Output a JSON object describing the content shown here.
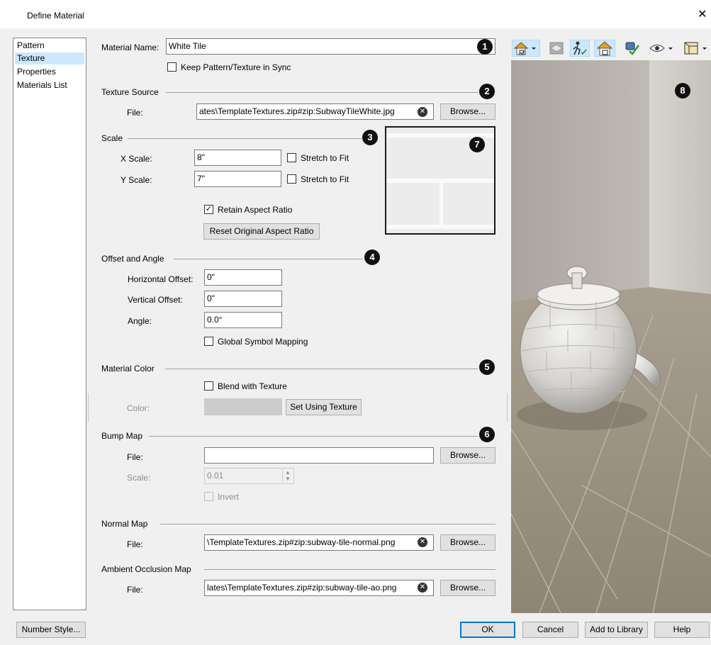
{
  "window": {
    "title": "Define Material",
    "close_glyph": "✕"
  },
  "nav": {
    "items": [
      "Pattern",
      "Texture",
      "Properties",
      "Materials List"
    ],
    "selected_index": 1
  },
  "material_name": {
    "label": "Material Name:",
    "value": "White Tile"
  },
  "keep_sync": {
    "label": "Keep Pattern/Texture in Sync",
    "checked": false
  },
  "texture_source": {
    "heading": "Texture Source",
    "file_label": "File:",
    "file_value": "ates\\TemplateTextures.zip#zip:SubwayTileWhite.jpg",
    "browse_label": "Browse..."
  },
  "scale": {
    "heading": "Scale",
    "x_label": "X Scale:",
    "x_value": "8\"",
    "y_label": "Y Scale:",
    "y_value": "7\"",
    "stretch_label": "Stretch to Fit",
    "retain_label": "Retain Aspect Ratio",
    "retain_checked": true,
    "reset_label": "Reset Original Aspect Ratio"
  },
  "offset": {
    "heading": "Offset and Angle",
    "h_label": "Horizontal Offset:",
    "h_value": "0\"",
    "v_label": "Vertical Offset:",
    "v_value": "0\"",
    "angle_label": "Angle:",
    "angle_value": "0.0°",
    "global_label": "Global Symbol Mapping"
  },
  "material_color": {
    "heading": "Material Color",
    "blend_label": "Blend with Texture",
    "color_label": "Color:",
    "swatch_color": "#cccccc",
    "set_label": "Set Using Texture"
  },
  "bump_map": {
    "heading": "Bump Map",
    "file_label": "File:",
    "file_value": "",
    "browse_label": "Browse...",
    "scale_label": "Scale:",
    "scale_value": "0.01",
    "invert_label": "Invert"
  },
  "normal_map": {
    "heading": "Normal Map",
    "file_label": "File:",
    "file_value": "\\TemplateTextures.zip#zip:subway-tile-normal.png",
    "browse_label": "Browse..."
  },
  "ao_map": {
    "heading": "Ambient Occlusion Map",
    "file_label": "File:",
    "file_value": "lates\\TemplateTextures.zip#zip:subway-tile-ao.png",
    "browse_label": "Browse..."
  },
  "callouts": [
    "1",
    "2",
    "3",
    "4",
    "5",
    "6",
    "7",
    "8"
  ],
  "toolbar": {
    "icons": [
      "house-view-icon",
      "layers-icon",
      "walkthrough-icon",
      "house-check-icon",
      "render-check-icon",
      "camera-eye-icon",
      "room-box-icon"
    ]
  },
  "footer": {
    "number_style": "Number Style...",
    "ok": "OK",
    "cancel": "Cancel",
    "add_library": "Add to Library",
    "help": "Help"
  },
  "colors": {
    "selection": "#cce8ff",
    "accent": "#0078d7",
    "dialog_bg": "#f0f0f0"
  }
}
